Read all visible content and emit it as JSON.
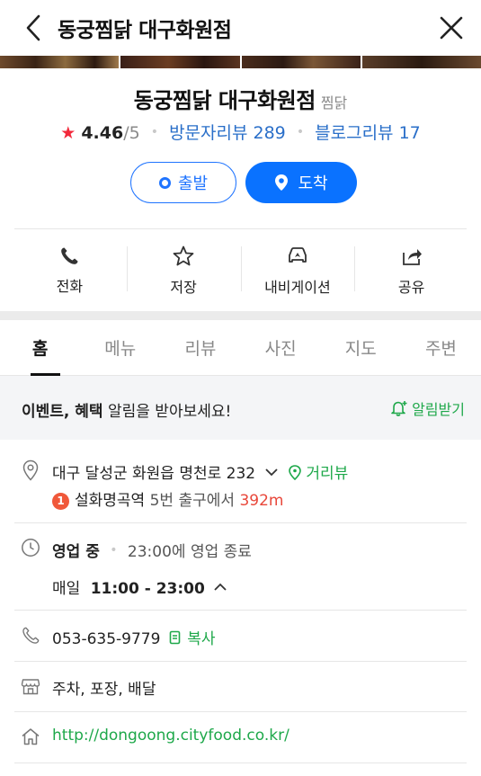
{
  "header": {
    "title": "동궁찜닭 대구화원점"
  },
  "store": {
    "name": "동궁찜닭 대구화원점",
    "category": "찜닭",
    "rating": "4.46",
    "rating_max": "/5",
    "visitor_reviews": "방문자리뷰 289",
    "blog_reviews": "블로그리뷰 17"
  },
  "route": {
    "start_label": "출발",
    "arrive_label": "도착"
  },
  "actions": [
    {
      "label": "전화",
      "icon": "phone-icon"
    },
    {
      "label": "저장",
      "icon": "star-outline-icon"
    },
    {
      "label": "내비게이션",
      "icon": "car-navigation-icon"
    },
    {
      "label": "공유",
      "icon": "share-icon"
    }
  ],
  "tabs": [
    {
      "label": "홈",
      "active": true
    },
    {
      "label": "메뉴"
    },
    {
      "label": "리뷰"
    },
    {
      "label": "사진"
    },
    {
      "label": "지도"
    },
    {
      "label": "주변"
    }
  ],
  "alert": {
    "bold_text": "이벤트, 혜택",
    "text": " 알림을 받아보세요!",
    "button_label": "알림받기"
  },
  "info": {
    "address": "대구 달성군 화원읍 명천로 232",
    "street_view_label": "거리뷰",
    "subway_line": "1",
    "subway_station": "설화명곡역",
    "subway_exit": " 5번 출구에서 ",
    "subway_distance": "392m",
    "status": "영업 중",
    "status_detail": "23:00에 영업 종료",
    "hours_day": "매일",
    "hours_time": "11:00 - 23:00",
    "phone": "053-635-9779",
    "copy_label": "복사",
    "amenities": "주차, 포장, 배달",
    "website": "http://dongoong.cityfood.co.kr/"
  },
  "colors": {
    "primary_blue": "#0a72ff",
    "naver_green": "#1ea84a",
    "star_red": "#f2293b",
    "distance_red": "#e8473a"
  }
}
